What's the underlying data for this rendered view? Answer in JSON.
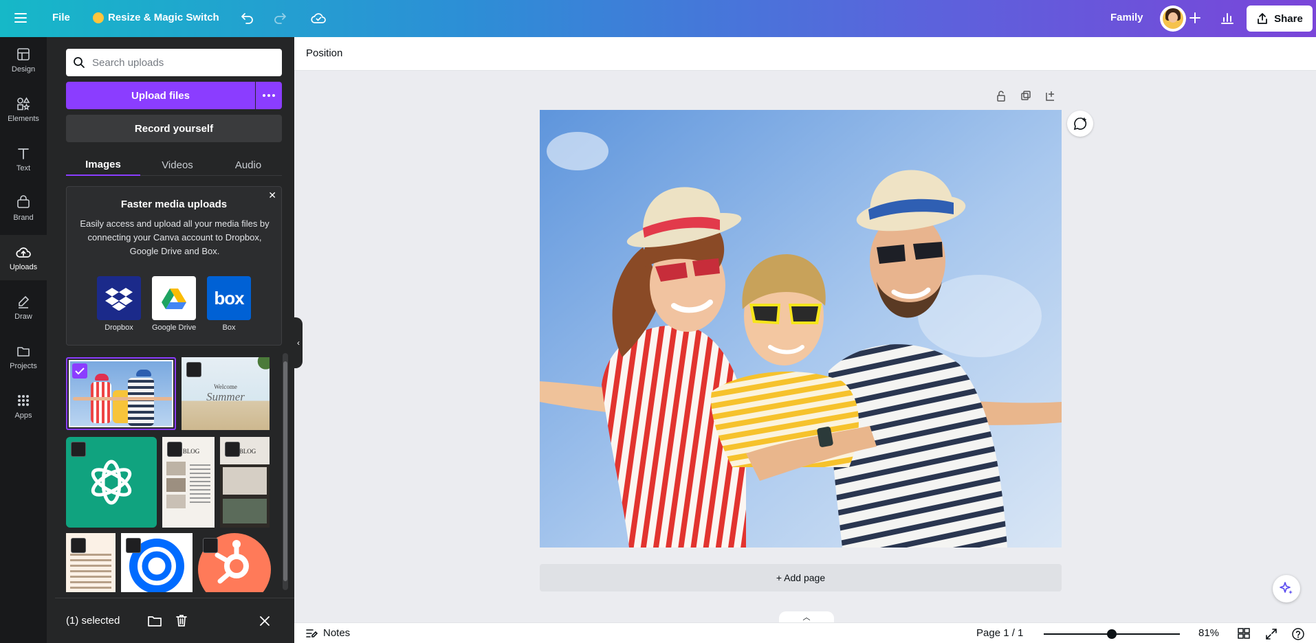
{
  "topbar": {
    "file_label": "File",
    "resize_label": "Resize & Magic Switch",
    "team_name": "Family",
    "share_label": "Share",
    "gradient_colors": [
      "#16b8c8",
      "#7a45d9"
    ]
  },
  "rail": {
    "items": [
      {
        "label": "Design",
        "icon": "design-icon"
      },
      {
        "label": "Elements",
        "icon": "elements-icon"
      },
      {
        "label": "Text",
        "icon": "text-icon"
      },
      {
        "label": "Brand",
        "icon": "brand-icon"
      },
      {
        "label": "Uploads",
        "icon": "uploads-icon",
        "active": true
      },
      {
        "label": "Draw",
        "icon": "draw-icon"
      },
      {
        "label": "Projects",
        "icon": "projects-icon"
      },
      {
        "label": "Apps",
        "icon": "apps-icon"
      }
    ]
  },
  "panel": {
    "search_placeholder": "Search uploads",
    "upload_label": "Upload files",
    "record_label": "Record yourself",
    "tabs": [
      "Images",
      "Videos",
      "Audio"
    ],
    "active_tab": "Images",
    "promo": {
      "title": "Faster media uploads",
      "body": "Easily access and upload all your media files by connecting your Canva account to Dropbox, Google Drive and Box.",
      "providers": [
        "Dropbox",
        "Google Drive",
        "Box"
      ]
    },
    "thumbnails": {
      "summer_welcome": "Welcome",
      "summer_script": "Summer",
      "blog_1": "E BLOG",
      "blog_2": "E BLOG",
      "box_logo": "box"
    },
    "selection": {
      "label": "(1) selected"
    }
  },
  "editor": {
    "context_label": "Position",
    "add_page_label": "+ Add page",
    "notes_label": "Notes",
    "page_indicator": "Page 1 / 1",
    "zoom_label": "81%",
    "zoom_level": 0.5
  },
  "colors": {
    "accent": "#8b3dff",
    "panel_bg": "#252627",
    "rail_bg": "#18191b"
  }
}
